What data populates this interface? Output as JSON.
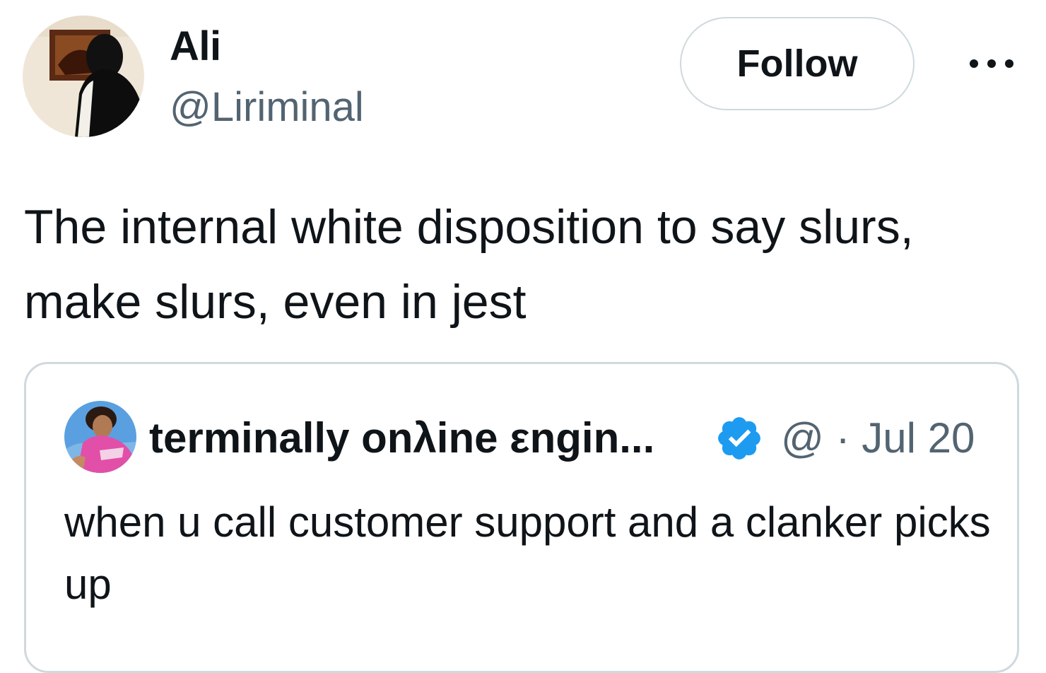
{
  "tweet": {
    "author": {
      "display_name": "Ali",
      "handle": "@Liriminal"
    },
    "follow_label": "Follow",
    "more_icon": "more-dots-icon",
    "text": "The internal white disposition to say slurs, make slurs, even in jest"
  },
  "quote": {
    "author": {
      "display_name": "terminally onλine εngin...",
      "handle": "@",
      "verified": true
    },
    "separator": "·",
    "date": "Jul 20",
    "text": "when u call customer support and a clanker picks up",
    "accent_color": "#1d9bf0"
  }
}
